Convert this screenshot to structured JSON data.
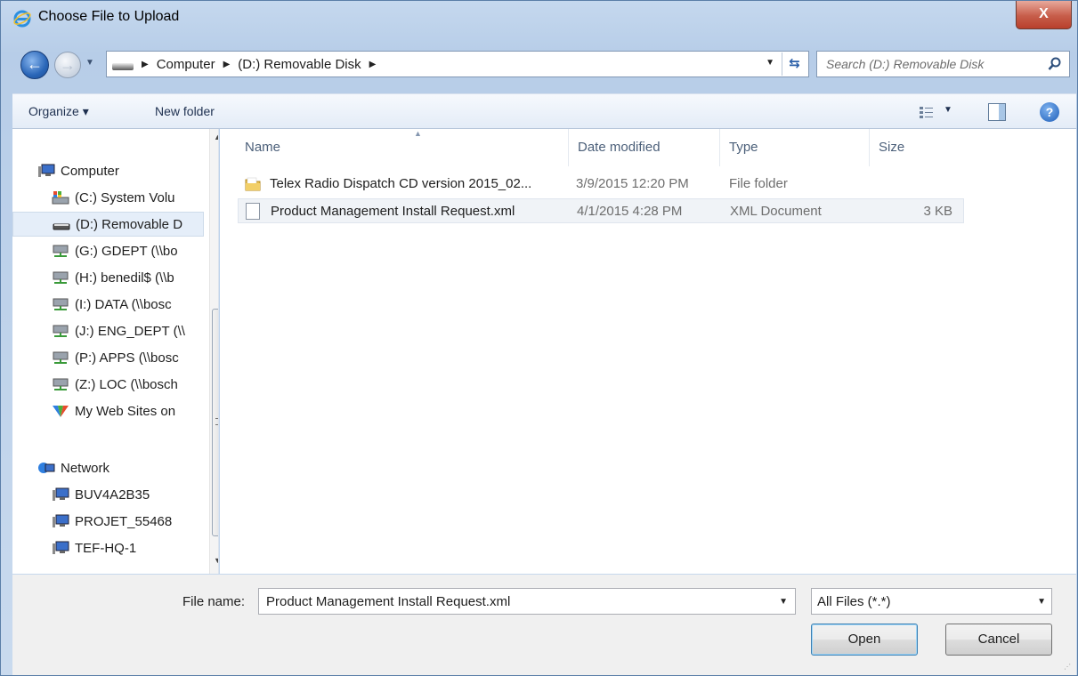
{
  "window": {
    "title": "Choose File to Upload",
    "close_label": "X"
  },
  "address": {
    "crumbs": [
      "Computer",
      "(D:) Removable Disk"
    ],
    "search_placeholder": "Search (D:) Removable Disk"
  },
  "toolbar": {
    "organize_label": "Organize ▾",
    "new_folder_label": "New folder",
    "help_label": "?"
  },
  "nav": {
    "items": [
      {
        "label": "Computer",
        "icon": "computer-icon"
      },
      {
        "label": "(C:) System Volu",
        "icon": "system-drive-icon"
      },
      {
        "label": "(D:) Removable D",
        "icon": "removable-drive-icon",
        "selected": true
      },
      {
        "label": "(G:) GDEPT (\\\\bo",
        "icon": "network-drive-icon"
      },
      {
        "label": "(H:) benedil$ (\\\\b",
        "icon": "network-drive-icon"
      },
      {
        "label": "(I:) DATA (\\\\bosc",
        "icon": "network-drive-icon"
      },
      {
        "label": "(J:) ENG_DEPT (\\\\",
        "icon": "network-drive-icon"
      },
      {
        "label": "(P:) APPS (\\\\bosc",
        "icon": "network-drive-icon"
      },
      {
        "label": "(Z:) LOC (\\\\bosch",
        "icon": "network-drive-icon"
      },
      {
        "label": "My Web Sites on",
        "icon": "web-sites-icon"
      },
      {
        "label": "Network",
        "icon": "network-icon"
      },
      {
        "label": "BUV4A2B35",
        "icon": "computer-icon"
      },
      {
        "label": "PROJET_55468",
        "icon": "computer-icon"
      },
      {
        "label": "TEF-HQ-1",
        "icon": "computer-icon"
      }
    ]
  },
  "files": {
    "columns": [
      "Name",
      "Date modified",
      "Type",
      "Size"
    ],
    "rows": [
      {
        "name": "Telex Radio Dispatch CD version 2015_02...",
        "date": "3/9/2015 12:20 PM",
        "type": "File folder",
        "size": ""
      },
      {
        "name": "Product Management Install Request.xml",
        "date": "4/1/2015 4:28 PM",
        "type": "XML Document",
        "size": "3 KB"
      }
    ]
  },
  "bottom": {
    "file_name_label": "File name:",
    "file_name_value": "Product Management Install Request.xml",
    "filter_value": "All Files (*.*)",
    "open_label": "Open",
    "cancel_label": "Cancel"
  }
}
